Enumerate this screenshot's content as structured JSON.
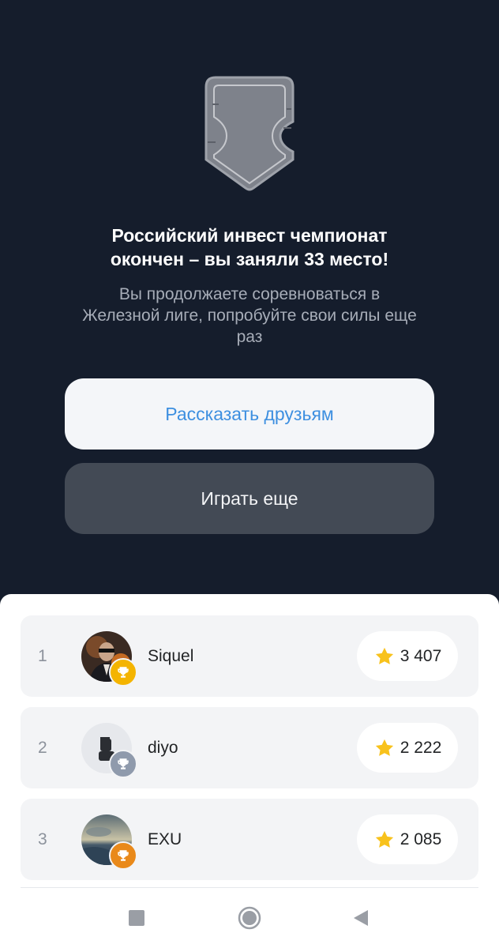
{
  "hero": {
    "badge_icon": "shield-badge-icon",
    "title_lines": [
      "Российский инвест чемпионат",
      "окончен – вы заняли 33 место!"
    ],
    "subtitle_lines": [
      "Вы продолжаете соревноваться в",
      "Железной лиге, попробуйте свои силы еще",
      "раз"
    ]
  },
  "actions": {
    "share_label": "Рассказать друзьям",
    "play_label": "Играть еще"
  },
  "leaderboard": {
    "rows": [
      {
        "rank": "1",
        "name": "Siquel",
        "score": "3 407",
        "trophy": "gold",
        "avatar": "photo-portrait"
      },
      {
        "rank": "2",
        "name": "diyo",
        "score": "2 222",
        "trophy": "silver",
        "avatar": "default-user"
      },
      {
        "rank": "3",
        "name": "EXU",
        "score": "2 085",
        "trophy": "bronze",
        "avatar": "photo-landscape"
      }
    ]
  },
  "colors": {
    "background": "#151d2c",
    "share_text": "#3d8fe0",
    "play_button": "#434a55",
    "gold": "#f4b400",
    "silver": "#8f9aac",
    "bronze": "#e9891a",
    "star": "#f8c21c"
  },
  "nav_bar": {
    "icons": [
      "recents-square-icon",
      "home-circle-icon",
      "back-triangle-icon"
    ]
  }
}
